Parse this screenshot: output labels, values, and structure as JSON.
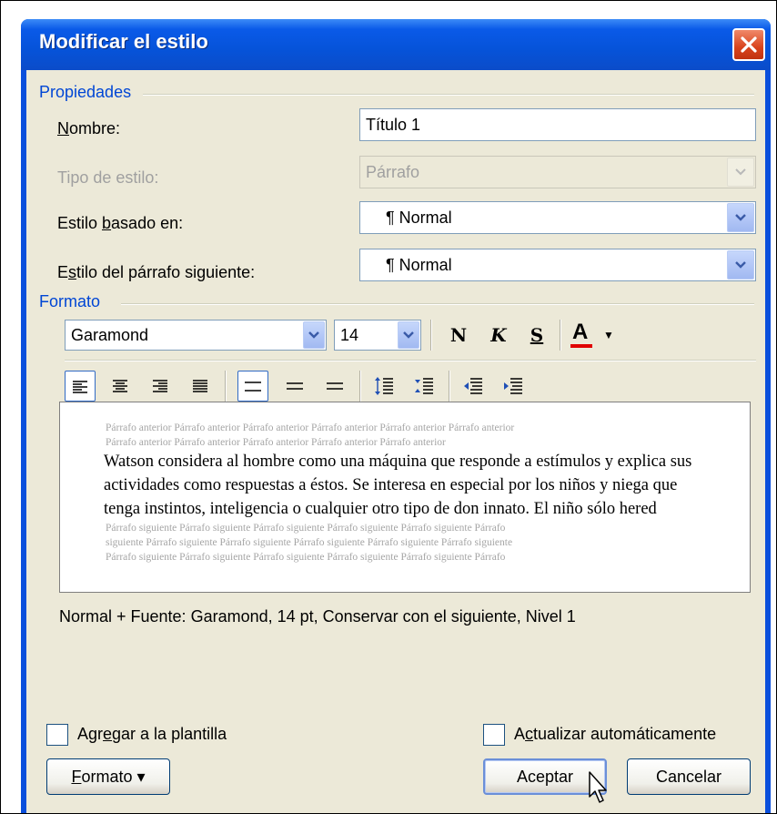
{
  "dialog": {
    "title": "Modificar el estilo"
  },
  "properties": {
    "group_label": "Propiedades",
    "name_label_pre": "",
    "name_label_u": "N",
    "name_label_post": "ombre:",
    "name_value": "Título 1",
    "type_label": "Tipo de estilo:",
    "type_value": "Párrafo",
    "based_label_pre": "Estilo ",
    "based_label_u": "b",
    "based_label_post": "asado en:",
    "based_value": "¶ Normal",
    "next_label_pre": "E",
    "next_label_u": "s",
    "next_label_post": "tilo del párrafo siguiente:",
    "next_value": "¶ Normal"
  },
  "format": {
    "group_label": "Formato",
    "font_value": "Garamond",
    "size_value": "14",
    "bold_label": "N",
    "italic_label": "K",
    "underline_label": "S",
    "font_color_label": "A",
    "font_color": "#e00000"
  },
  "preview": {
    "previous_line1": "Párrafo anterior Párrafo anterior Párrafo anterior Párrafo anterior Párrafo anterior Párrafo anterior",
    "previous_line2": "Párrafo anterior Párrafo anterior Párrafo anterior Párrafo anterior Párrafo anterior",
    "main_text": "Watson considera al hombre como una máquina que responde a estímulos y explica sus actividades como respuestas a éstos. Se interesa en especial por los niños y niega que tenga instintos, inteligencia o cualquier otro tipo de don innato. El niño sólo hered",
    "next_line1": "Párrafo siguiente Párrafo siguiente Párrafo siguiente Párrafo siguiente Párrafo siguiente Párrafo",
    "next_line2": "siguiente Párrafo siguiente Párrafo siguiente Párrafo siguiente Párrafo siguiente Párrafo siguiente",
    "next_line3": "Párrafo siguiente Párrafo siguiente Párrafo siguiente Párrafo siguiente Párrafo siguiente Párrafo"
  },
  "description": "Normal + Fuente: Garamond, 14 pt, Conservar con el siguiente, Nivel 1",
  "footer": {
    "add_template_pre": "Agr",
    "add_template_u": "e",
    "add_template_post": "gar a la plantilla",
    "auto_update_pre": "A",
    "auto_update_u": "c",
    "auto_update_post": "tualizar automáticamente",
    "format_button_u": "F",
    "format_button_post": "ormato",
    "format_button_arrow": "▾",
    "ok_label": "Aceptar",
    "cancel_label": "Cancelar"
  }
}
